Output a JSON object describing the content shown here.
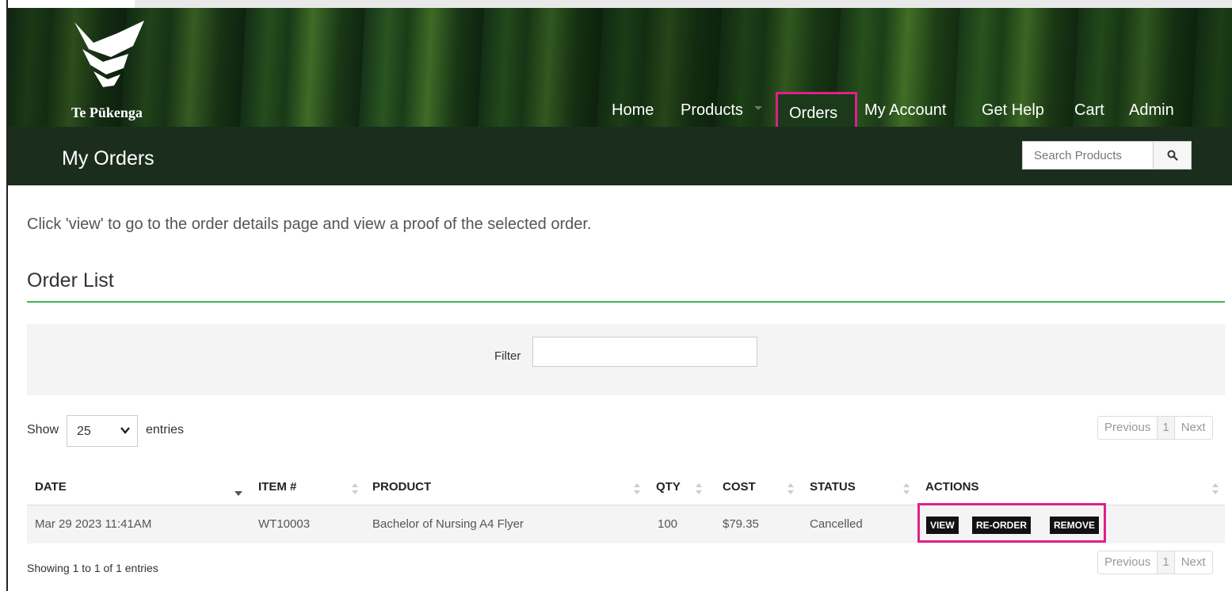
{
  "brand": {
    "name": "Te Pūkenga"
  },
  "nav": {
    "items": [
      {
        "label": "Home"
      },
      {
        "label": "Products"
      },
      {
        "label": "Orders"
      },
      {
        "label": "My Account"
      },
      {
        "label": "Get Help"
      },
      {
        "label": "Cart"
      },
      {
        "label": "Admin"
      }
    ],
    "active": "Orders"
  },
  "subbar": {
    "title": "My Orders",
    "search_placeholder": "Search Products"
  },
  "content": {
    "intro": "Click 'view' to go to the order details page and view a proof of the selected order.",
    "section_title": "Order List",
    "filter_label": "Filter",
    "filter_value": "",
    "show_label": "Show",
    "page_size": "25",
    "entries_label": "entries",
    "pager": {
      "prev": "Previous",
      "page": "1",
      "next": "Next"
    },
    "showing": "Showing 1 to 1 of 1 entries"
  },
  "table": {
    "columns": [
      "DATE",
      "ITEM #",
      "PRODUCT",
      "QTY",
      "COST",
      "STATUS",
      "ACTIONS"
    ],
    "rows": [
      {
        "date": "Mar 29 2023 11:41AM",
        "item": "WT10003",
        "product": "Bachelor of Nursing A4 Flyer",
        "qty": "100",
        "cost": "$79.35",
        "status": "Cancelled"
      }
    ],
    "actions": [
      "VIEW",
      "RE-ORDER",
      "REMOVE"
    ]
  },
  "colors": {
    "header_bg": "#1b2e1e",
    "highlight": "#e0208a",
    "section_rule": "#3bb44a"
  },
  "icons": [
    "logo-mark-icon",
    "search-icon",
    "chevron-down-icon",
    "sort-icon",
    "sort-desc-icon"
  ]
}
